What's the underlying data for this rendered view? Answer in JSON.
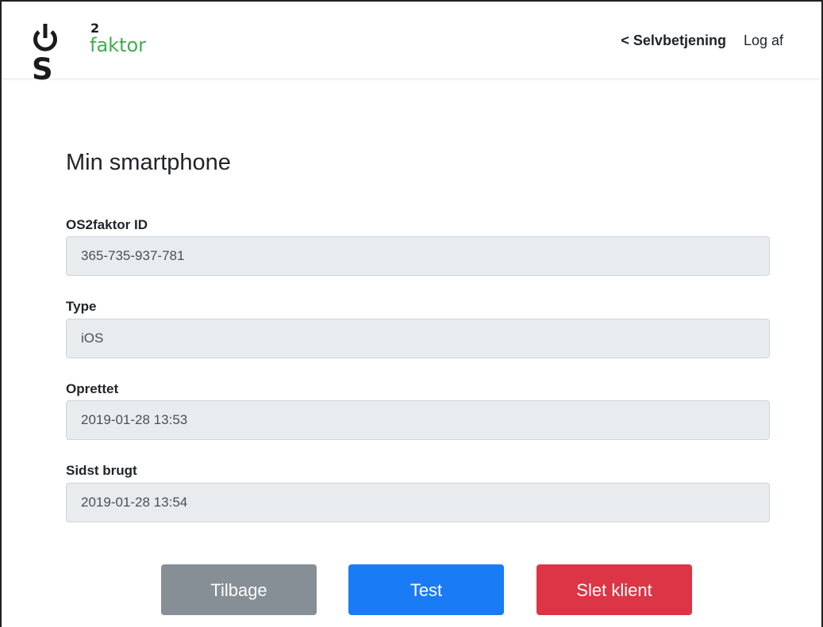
{
  "brand": {
    "logo_text": "OS",
    "logo_superscript": "2",
    "logo_subtext": "faktor",
    "accent_color": "#3fae4e"
  },
  "nav": {
    "selfservice_label": "< Selvbetjening",
    "logout_label": "Log af"
  },
  "page": {
    "title": "Min smartphone"
  },
  "fields": {
    "id": {
      "label": "OS2faktor ID",
      "value": "365-735-937-781"
    },
    "type": {
      "label": "Type",
      "value": "iOS"
    },
    "created": {
      "label": "Oprettet",
      "value": "2019-01-28 13:53"
    },
    "last_used": {
      "label": "Sidst brugt",
      "value": "2019-01-28 13:54"
    }
  },
  "actions": {
    "back_label": "Tilbage",
    "test_label": "Test",
    "delete_label": "Slet klient",
    "colors": {
      "back": "#868e96",
      "test": "#1a7cf5",
      "delete": "#dc3545"
    }
  }
}
